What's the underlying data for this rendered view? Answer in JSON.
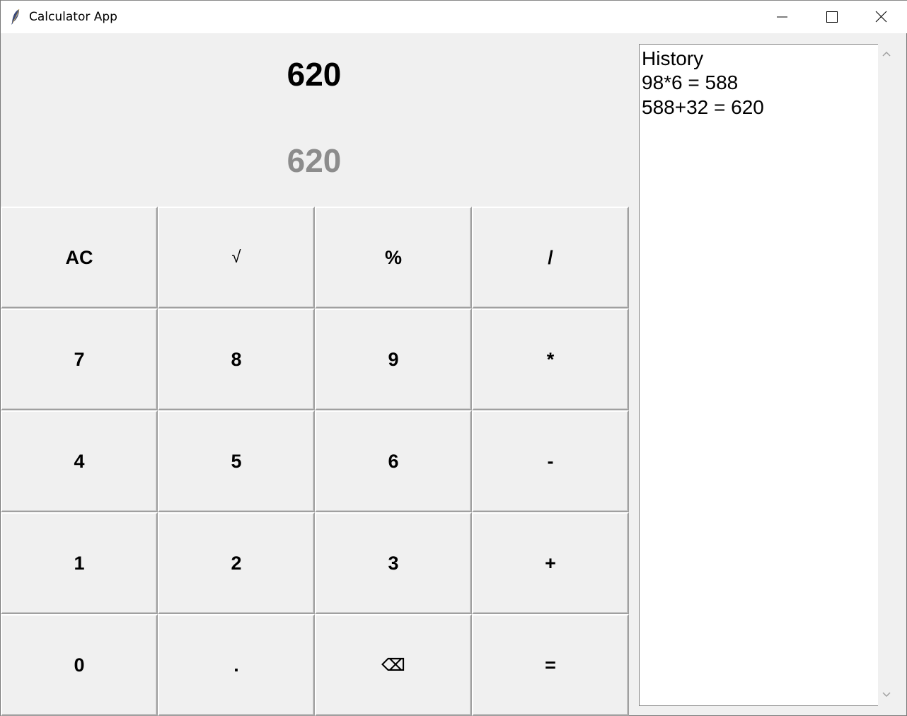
{
  "window": {
    "title": "Calculator App",
    "icon": "feather-icon"
  },
  "display": {
    "expression": "620",
    "result": "620"
  },
  "keypad": {
    "rows": [
      [
        "AC",
        "√",
        "%",
        "/"
      ],
      [
        "7",
        "8",
        "9",
        "*"
      ],
      [
        "4",
        "5",
        "6",
        "-"
      ],
      [
        "1",
        "2",
        "3",
        "+"
      ],
      [
        "0",
        ".",
        "⌫",
        "="
      ]
    ]
  },
  "history": {
    "heading": "History",
    "entries": [
      "98*6 = 588",
      "588+32 = 620"
    ]
  }
}
